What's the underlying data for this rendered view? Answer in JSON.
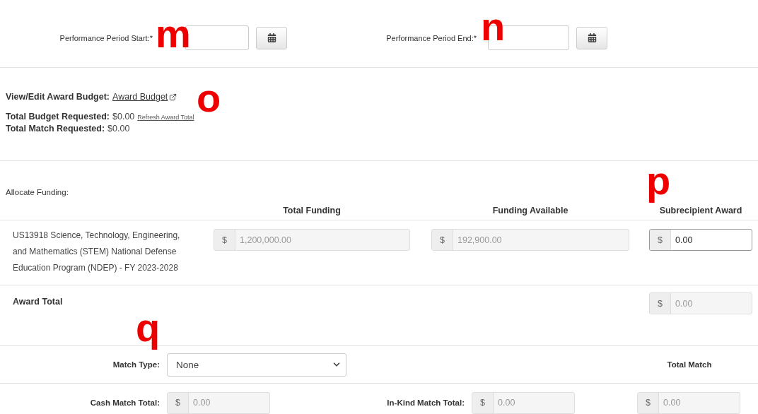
{
  "period": {
    "start": {
      "label": "Performance Period Start:*",
      "marker": "m"
    },
    "end": {
      "label": "Performance Period End:*",
      "marker": "n"
    }
  },
  "budget": {
    "label": "View/Edit Award Budget:",
    "link": "Award Budget",
    "marker": "o",
    "total_budget_label": "Total Budget Requested:",
    "total_budget": "$0.00",
    "refresh_link": "Refresh Award Total",
    "total_match_label": "Total Match Requested:",
    "total_match": "$0.00"
  },
  "allocate": {
    "title": "Allocate Funding:",
    "marker": "p",
    "columns": [
      "Total Funding",
      "Funding Available",
      "Subrecipient Award"
    ],
    "rows": [
      {
        "program": "US13918 Science, Technology, Engineering, and Mathematics (STEM) National Defense Education Program (NDEP) - FY 2023-2028",
        "fields": [
          {
            "prefix": "$",
            "value": "1,200,000.00",
            "disabled": true
          },
          {
            "prefix": "$",
            "value": "192,900.00",
            "disabled": true
          },
          {
            "prefix": "$",
            "value": "0.00",
            "disabled": false
          }
        ]
      }
    ],
    "award_total": {
      "label": "Award Total",
      "field": {
        "prefix": "$",
        "value": "0.00",
        "disabled": true
      }
    }
  },
  "match": {
    "marker": "q",
    "type_label": "Match Type:",
    "type_value": "None",
    "total_label": "Total Match",
    "fields": [
      {
        "label": "Cash Match Total:",
        "prefix": "$",
        "value": "0.00",
        "disabled": true
      },
      {
        "label": "In-Kind Match Total:",
        "prefix": "$",
        "value": "0.00",
        "disabled": true
      },
      {
        "prefix": "$",
        "value": "0.00",
        "disabled": true
      }
    ]
  }
}
